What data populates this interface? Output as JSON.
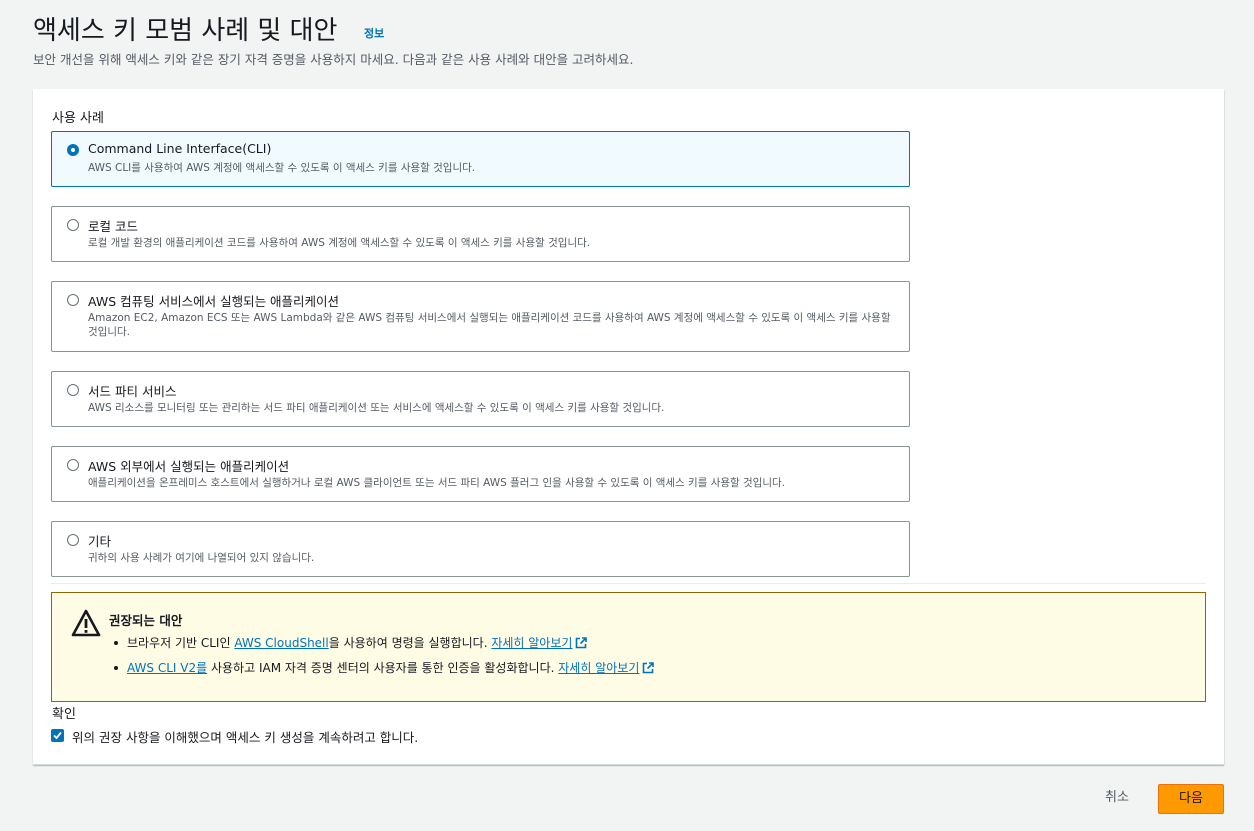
{
  "header": {
    "title": "액세스 키 모범 사례 및 대안",
    "info_link": "정보",
    "description": "보안 개선을 위해 액세스 키와 같은 장기 자격 증명을 사용하지 마세요. 다음과 같은 사용 사례와 대안을 고려하세요."
  },
  "use_cases": {
    "label": "사용 사례",
    "selected_index": 0,
    "options": [
      {
        "title": "Command Line Interface(CLI)",
        "description": "AWS CLI를 사용하여 AWS 계정에 액세스할 수 있도록 이 액세스 키를 사용할 것입니다."
      },
      {
        "title": "로컬 코드",
        "description": "로컬 개발 환경의 애플리케이션 코드를 사용하여 AWS 계정에 액세스할 수 있도록 이 액세스 키를 사용할 것입니다."
      },
      {
        "title": "AWS 컴퓨팅 서비스에서 실행되는 애플리케이션",
        "description": "Amazon EC2, Amazon ECS 또는 AWS Lambda와 같은 AWS 컴퓨팅 서비스에서 실행되는 애플리케이션 코드를 사용하여 AWS 계정에 액세스할 수 있도록 이 액세스 키를 사용할 것입니다."
      },
      {
        "title": "서드 파티 서비스",
        "description": "AWS 리소스를 모니터링 또는 관리하는 서드 파티 애플리케이션 또는 서비스에 액세스할 수 있도록 이 액세스 키를 사용할 것입니다."
      },
      {
        "title": "AWS 외부에서 실행되는 애플리케이션",
        "description": "애플리케이션을 온프레미스 호스트에서 실행하거나 로컬 AWS 클라이언트 또는 서드 파티 AWS 플러그 인을 사용할 수 있도록 이 액세스 키를 사용할 것입니다."
      },
      {
        "title": "기타",
        "description": "귀하의 사용 사례가 여기에 나열되어 있지 않습니다."
      }
    ]
  },
  "alert": {
    "title": "권장되는 대안",
    "item1_prefix": "브라우저 기반 CLI인 ",
    "item1_link": "AWS CloudShell",
    "item1_suffix": "을 사용하여 명령을 실행합니다. ",
    "item1_more": "자세히 알아보기",
    "item2_link": "AWS CLI V2를",
    "item2_suffix": " 사용하고 IAM 자격 증명 센터의 사용자를 통한 인증을 활성화합니다. ",
    "item2_more": "자세히 알아보기"
  },
  "confirm": {
    "label": "확인",
    "checkbox_text": "위의 권장 사항을 이해했으며 액세스 키 생성을 계속하려고 합니다.",
    "checked": true
  },
  "footer": {
    "cancel_label": "취소",
    "next_label": "다음"
  },
  "colors": {
    "primary": "#0073bb",
    "warning_bg": "#fffce6",
    "button_orange": "#ff9900"
  }
}
